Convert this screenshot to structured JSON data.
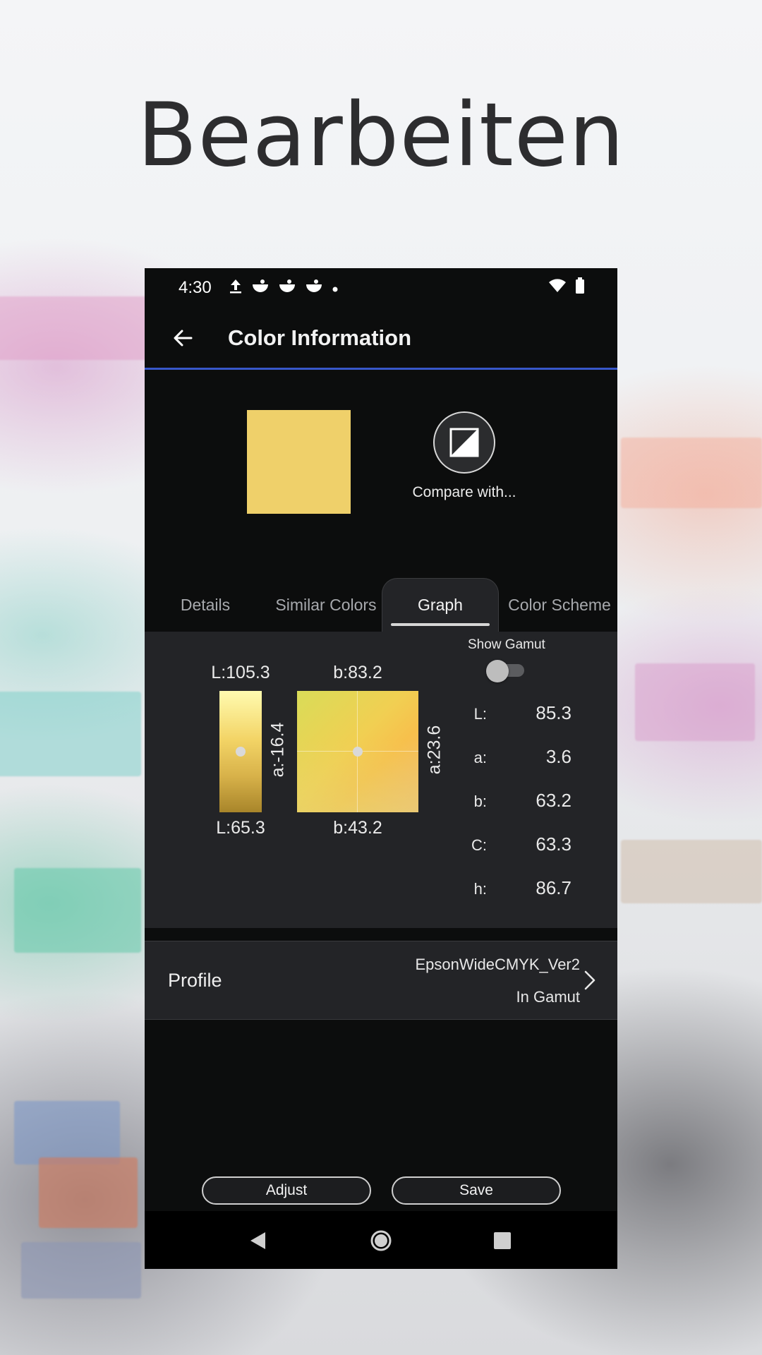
{
  "headline": "Bearbeiten",
  "status_bar": {
    "time": "4:30",
    "icons": [
      "upload-icon",
      "notification-icon",
      "notification-icon",
      "notification-icon",
      "dot-icon",
      "wifi-icon",
      "battery-icon"
    ]
  },
  "app_bar": {
    "title": "Color Information",
    "back_icon": "arrow-back-icon"
  },
  "color": {
    "swatch_hex": "#EFD06A",
    "compare_label": "Compare with...",
    "compare_icon": "compare-icon"
  },
  "tabs": [
    {
      "label": "Details",
      "active": false
    },
    {
      "label": "Similar Colors",
      "active": false
    },
    {
      "label": "Graph",
      "active": true
    },
    {
      "label": "Color Scheme",
      "active": false
    }
  ],
  "graph": {
    "l_top": "L:105.3",
    "l_bottom": "L:65.3",
    "b_top": "b:83.2",
    "b_bottom": "b:43.2",
    "a_left": "a:-16.4",
    "a_right": "a:23.6",
    "show_gamut_label": "Show Gamut",
    "show_gamut_on": false
  },
  "lab_values": [
    {
      "key": "L:",
      "value": "85.3"
    },
    {
      "key": "a:",
      "value": "3.6"
    },
    {
      "key": "b:",
      "value": "63.2"
    },
    {
      "key": "C:",
      "value": "63.3"
    },
    {
      "key": "h:",
      "value": "86.7"
    }
  ],
  "profile": {
    "label": "Profile",
    "name": "EpsonWideCMYK_Ver2",
    "status": "In Gamut"
  },
  "actions": {
    "adjust": "Adjust",
    "save": "Save"
  },
  "nav": [
    "back-triangle-icon",
    "home-circle-icon",
    "recents-square-icon"
  ],
  "colors": {
    "accent": "#3857C9",
    "background": "#0C0D0D",
    "panel": "#232427"
  }
}
